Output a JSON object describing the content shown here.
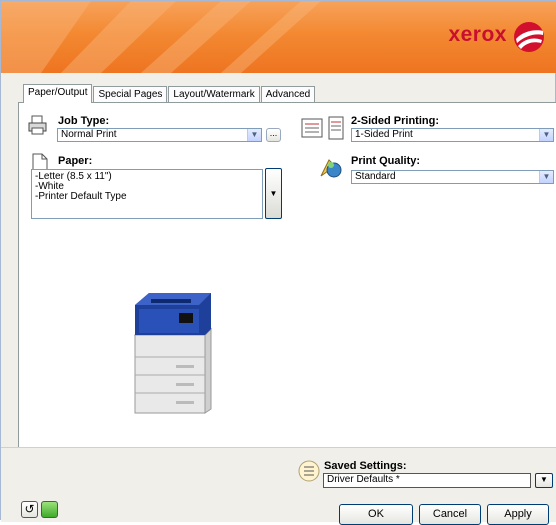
{
  "brand": {
    "logo_text": "xerox",
    "banner_color": "#f38932",
    "logo_color": "#c8102e"
  },
  "tabs": [
    {
      "label": "Paper/Output",
      "active": true
    },
    {
      "label": "Special Pages",
      "active": false
    },
    {
      "label": "Layout/Watermark",
      "active": false
    },
    {
      "label": "Advanced",
      "active": false
    }
  ],
  "job_type": {
    "label": "Job Type:",
    "value": "Normal Print",
    "icon": "printer-icon"
  },
  "two_sided": {
    "label": "2-Sided Printing:",
    "value": "1-Sided Print",
    "icon": "two-sided-icon"
  },
  "paper": {
    "label": "Paper:",
    "lines": [
      "-Letter (8.5 x 11\")",
      "-White",
      "-Printer Default Type"
    ],
    "icon": "paper-icon"
  },
  "print_quality": {
    "label": "Print Quality:",
    "value": "Standard",
    "icon": "quality-icon"
  },
  "saved_settings": {
    "label": "Saved Settings:",
    "value": "Driver Defaults *",
    "icon": "saved-settings-icon"
  },
  "buttons": {
    "ok": "OK",
    "cancel": "Cancel",
    "apply": "Apply",
    "ellipsis": "..."
  }
}
